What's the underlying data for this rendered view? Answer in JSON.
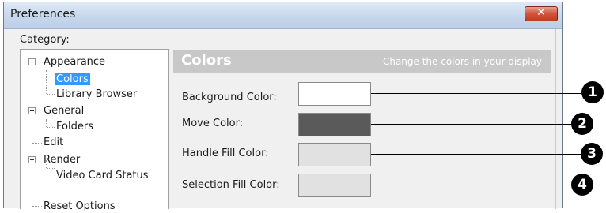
{
  "window": {
    "title": "Preferences",
    "close_glyph": "✕",
    "close_icon": "close-icon"
  },
  "category_label": "Category:",
  "tree": [
    {
      "label": "Appearance",
      "expanded": true
    },
    {
      "label": "Colors",
      "selected": true
    },
    {
      "label": "Library Browser"
    },
    {
      "label": "General",
      "expanded": true
    },
    {
      "label": "Folders"
    },
    {
      "label": "Edit"
    },
    {
      "label": "Render",
      "expanded": true
    },
    {
      "label": "Video Card Status"
    },
    {
      "label": "Reset Options"
    }
  ],
  "panel": {
    "title": "Colors",
    "subtitle": "Change the colors in your display"
  },
  "rows": [
    {
      "label": "Background Color:",
      "color": "#ffffff",
      "badge": "1"
    },
    {
      "label": "Move Color:",
      "color": "#5a5a5a",
      "badge": "2"
    },
    {
      "label": "Handle Fill Color:",
      "color": "#e1e1e1",
      "badge": "3"
    },
    {
      "label": "Selection Fill Color:",
      "color": "#e1e1e1",
      "badge": "4"
    }
  ],
  "colors": {
    "selection": "#3399ff",
    "header_bg": "#c8c8c8"
  }
}
